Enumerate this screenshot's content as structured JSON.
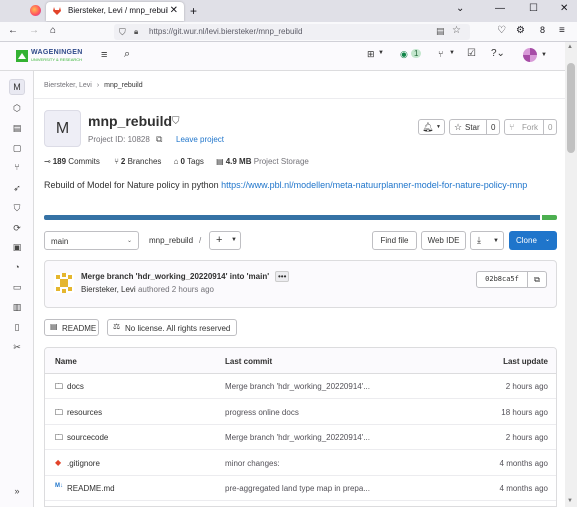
{
  "browser": {
    "tab_title": "Biersteker, Levi / mnp_rebuild · G",
    "url": "https://git.wur.nl/levi.biersteker/mnp_rebuild",
    "menu_badge": "8"
  },
  "topnav": {
    "logo_text": "WAGENINGEN",
    "logo_sub": "UNIVERSITY & RESEARCH",
    "issues_count": "1"
  },
  "sidebar": {
    "project_letter": "M"
  },
  "breadcrumb": {
    "group": "Biersteker, Levi",
    "sep": "›",
    "project": "mnp_rebuild"
  },
  "project": {
    "avatar_letter": "M",
    "name": "mnp_rebuild",
    "id_label": "Project ID: 10828",
    "leave": "Leave project",
    "star_label": "Star",
    "star_count": "0",
    "fork_label": "Fork",
    "fork_count": "0"
  },
  "stats": {
    "commits_num": "189",
    "commits_label": "Commits",
    "branches_num": "2",
    "branches_label": "Branches",
    "tags_num": "0",
    "tags_label": "Tags",
    "storage_num": "4.9 MB",
    "storage_label": "Project Storage"
  },
  "description": {
    "text": "Rebuild of Model for Nature policy in python ",
    "link": "https://www.pbl.nl/modellen/meta-natuurplanner-model-for-nature-policy-mnp"
  },
  "language_bar": [
    {
      "share": 0.97,
      "color": "#3572a5"
    },
    {
      "share": 0.03,
      "color": "#4caf50"
    }
  ],
  "repo_nav": {
    "branch": "main",
    "path": "mnp_rebuild",
    "path_sep": "/",
    "plus": "+",
    "find_file": "Find file",
    "web_ide": "Web IDE",
    "clone": "Clone"
  },
  "last_commit": {
    "message": "Merge branch 'hdr_working_20220914' into 'main'",
    "author": "Biersteker, Levi",
    "authored": "authored 2 hours ago",
    "sha": "02b8ca5f"
  },
  "badges": {
    "readme": "README",
    "license": "No license. All rights reserved"
  },
  "file_table": {
    "headers": [
      "Name",
      "Last commit",
      "Last update"
    ],
    "rows": [
      {
        "icon": "folder-icon",
        "name": "docs",
        "commit": "Merge branch 'hdr_working_20220914'...",
        "time": "2 hours ago"
      },
      {
        "icon": "folder-icon",
        "name": "resources",
        "commit": "progress online docs",
        "time": "18 hours ago"
      },
      {
        "icon": "folder-icon",
        "name": "sourcecode",
        "commit": "Merge branch 'hdr_working_20220914'...",
        "time": "2 hours ago"
      },
      {
        "icon": "git-icon",
        "name": ".gitignore",
        "commit": "minor changes:",
        "time": "4 months ago"
      },
      {
        "icon": "markdown-icon",
        "name": "README.md",
        "commit": "pre-aggregated land type map in prepa...",
        "time": "4 months ago"
      }
    ]
  }
}
